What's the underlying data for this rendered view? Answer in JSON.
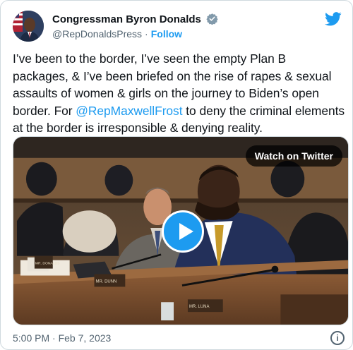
{
  "author": {
    "display_name": "Congressman Byron Donalds",
    "handle": "@RepDonaldsPress",
    "follow_label": "Follow",
    "verified": true,
    "avatar_icon": "profile-photo"
  },
  "brand": {
    "icon": "twitter-bird-icon",
    "color": "#1d9bf0"
  },
  "tweet": {
    "text_1": "I’ve been to the border, I’ve seen the empty Plan B packages, & I’ve been briefed on the rise of rapes & sexual assaults of women & girls on the journey to Biden’s open border. For ",
    "mention": "@RepMaxwellFrost",
    "text_2": " to deny the criminal elements at the border is irresponsible & denying reality."
  },
  "media": {
    "watch_label": "Watch on Twitter",
    "play_icon": "play-icon",
    "placards": [
      "MR. DONALDS",
      "MR. DUNN",
      "MR. LUNA"
    ]
  },
  "footer": {
    "timestamp": "5:00 PM · Feb 7, 2023",
    "info_icon": "info-icon",
    "info_glyph": "i"
  },
  "colors": {
    "link": "#1d9bf0",
    "secondary_text": "#536471",
    "border": "#cfd9de"
  }
}
